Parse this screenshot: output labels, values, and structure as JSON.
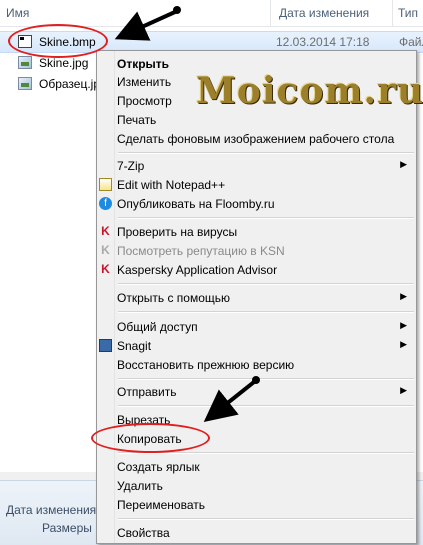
{
  "header": {
    "col_name": "Имя",
    "col_date": "Дата изменения",
    "col_type": "Тип"
  },
  "files": [
    {
      "name": "Skine.bmp",
      "date": "12.03.2014 17:18",
      "type": "Файл",
      "icon": "bmp-file-icon"
    },
    {
      "name": "Skine.jpg",
      "date": "",
      "type": "",
      "icon": "image-file-icon"
    },
    {
      "name": "Образец.jpg",
      "date": "",
      "type": "",
      "icon": "image-file-icon"
    }
  ],
  "details_pane": {
    "date_label": "Дата изменения",
    "size_label": "Размеры"
  },
  "watermark": "Moicom.ru",
  "context_menu": {
    "open": "Открыть",
    "edit": "Изменить",
    "preview": "Просмотр",
    "print": "Печать",
    "set_wallpaper": "Сделать фоновым изображением рабочего стола",
    "zip": "7-Zip",
    "notepad": "Edit with Notepad++",
    "floomby": "Опубликовать на Floomby.ru",
    "scan": "Проверить на вирусы",
    "ksn": "Посмотреть репутацию в KSN",
    "kaspersky": "Kaspersky Application Advisor",
    "open_with": "Открыть с помощью",
    "share": "Общий доступ",
    "snagit": "Snagit",
    "restore": "Восстановить прежнюю версию",
    "send_to": "Отправить",
    "cut": "Вырезать",
    "copy": "Копировать",
    "shortcut": "Создать ярлык",
    "delete": "Удалить",
    "rename": "Переименовать",
    "properties": "Свойства"
  },
  "colors": {
    "annotation": "#e31e1e",
    "menu_bg": "#f0f0f0",
    "selection": "#d7e8fc"
  }
}
